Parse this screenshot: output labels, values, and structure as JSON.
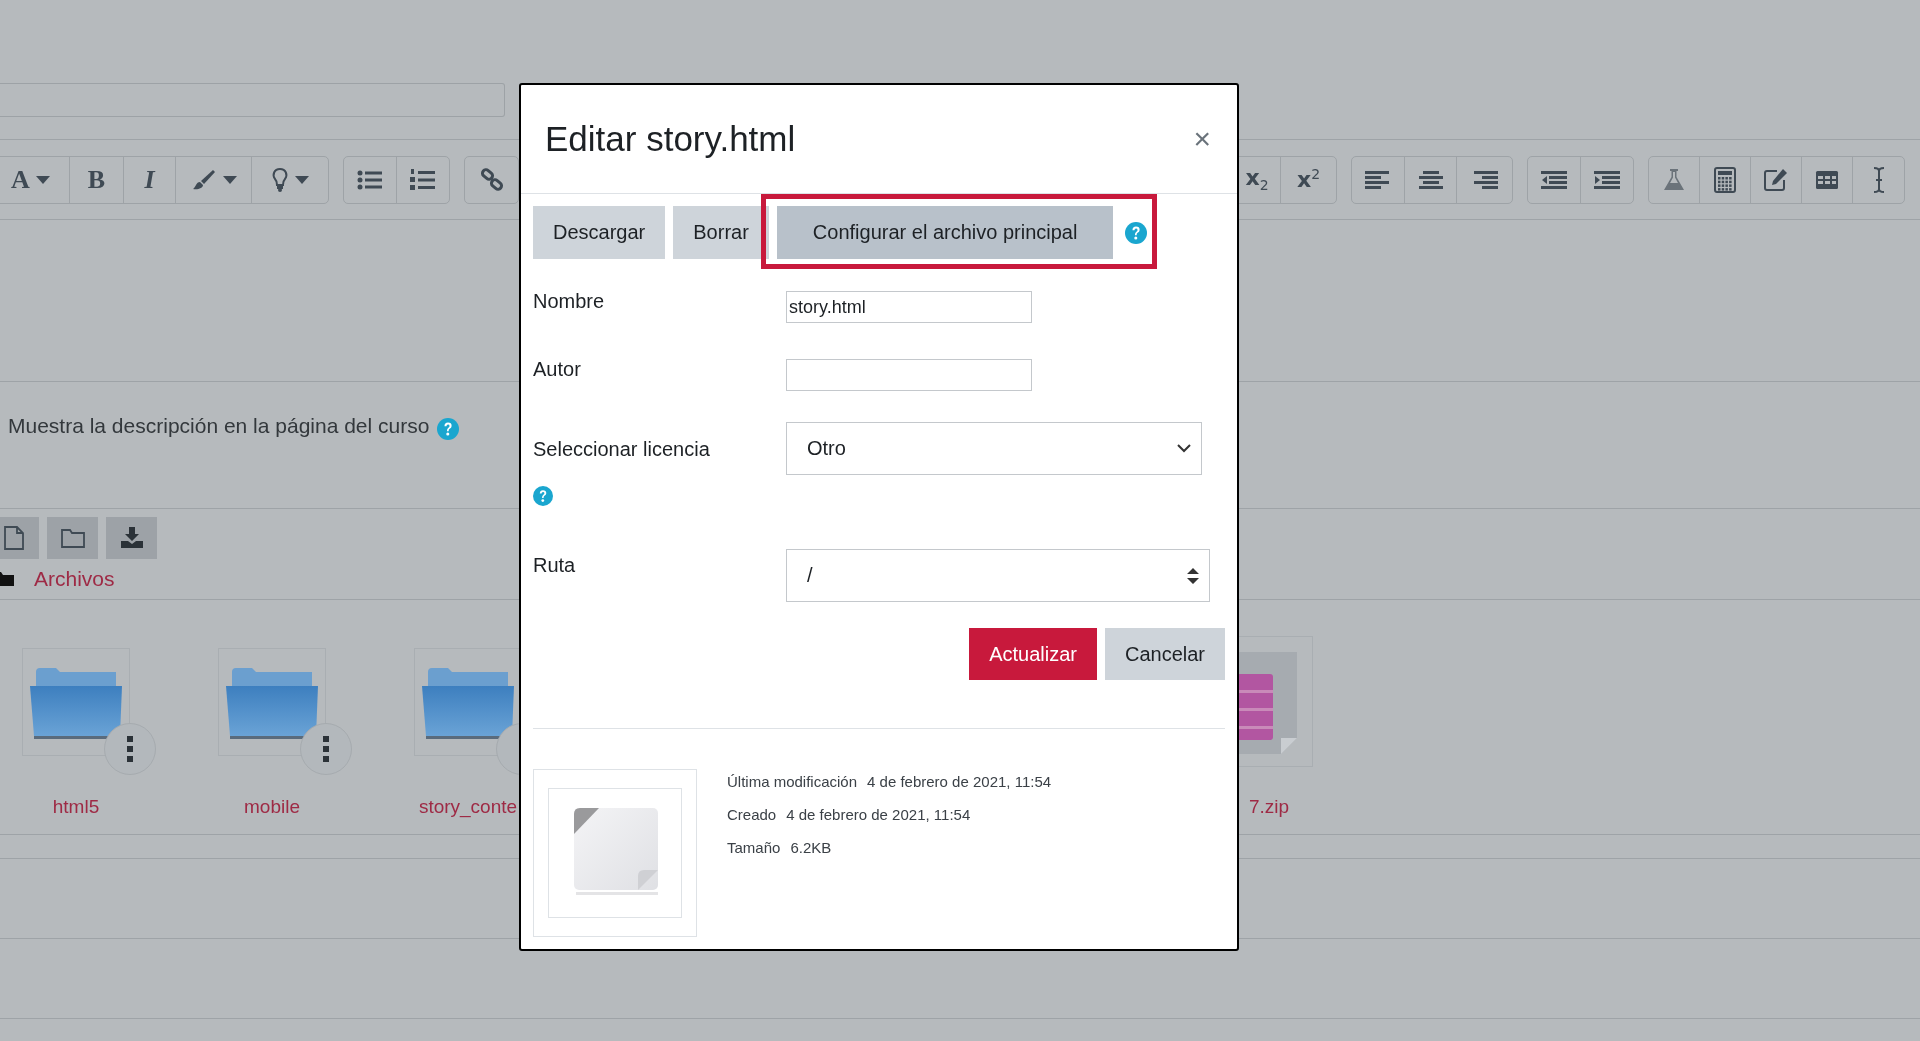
{
  "editor_toolbar": {
    "left_groups": [
      [
        {
          "kind": "font",
          "text": "A",
          "menu": true
        },
        {
          "kind": "bold",
          "text": "B",
          "menu": false
        },
        {
          "kind": "italic",
          "text": "I",
          "menu": false
        },
        {
          "kind": "brush",
          "menu": true
        },
        {
          "kind": "bulb",
          "menu": true
        }
      ],
      [
        {
          "kind": "bullets",
          "menu": false
        },
        {
          "kind": "numbers",
          "menu": false
        }
      ],
      [
        {
          "kind": "link",
          "menu": false
        }
      ]
    ],
    "right_groups": [
      [
        {
          "kind": "subscript",
          "text": "x$_{2}$",
          "menu": false
        },
        {
          "kind": "superscript",
          "text": "x$^{2}$",
          "menu": false
        }
      ],
      [
        {
          "kind": "align-left",
          "menu": false
        },
        {
          "kind": "align-center",
          "menu": false
        },
        {
          "kind": "align-right",
          "menu": false
        }
      ],
      [
        {
          "kind": "outdent",
          "menu": false
        },
        {
          "kind": "indent",
          "menu": false
        }
      ],
      [
        {
          "kind": "flask",
          "menu": false
        },
        {
          "kind": "calculator",
          "menu": false
        },
        {
          "kind": "edit",
          "menu": false
        },
        {
          "kind": "table",
          "menu": false
        },
        {
          "kind": "cursor",
          "menu": false
        }
      ]
    ]
  },
  "description_setting": {
    "label": "Muestra la descripción en la página del curso"
  },
  "file_manager": {
    "path": "Archivos",
    "items": [
      {
        "name": "html5",
        "kind": "folder"
      },
      {
        "name": "mobile",
        "kind": "folder"
      },
      {
        "name": "story_conte",
        "kind": "folder"
      },
      {
        "name": "7.zip",
        "kind": "zip"
      }
    ]
  },
  "dialog": {
    "title": "Editar story.html",
    "close": "×",
    "actions": [
      {
        "label": "Descargar",
        "highlighted": false
      },
      {
        "label": "Borrar",
        "highlighted": false
      },
      {
        "label": "Configurar el archivo principal",
        "highlighted": true
      }
    ],
    "fields": [
      {
        "kind": "text",
        "label": "Nombre",
        "value": "story.html",
        "help": false
      },
      {
        "kind": "text",
        "label": "Autor",
        "help": false
      },
      {
        "kind": "select",
        "label": "Seleccionar licencia",
        "value": "Otro",
        "help": true
      },
      {
        "kind": "path",
        "label": "Ruta",
        "value": "/",
        "help": false
      }
    ],
    "buttons": [
      {
        "label": "Actualizar",
        "kind": "primary"
      },
      {
        "label": "Cancelar",
        "kind": "secondary"
      }
    ],
    "details": [
      {
        "label": "Última modificación",
        "value": "4 de febrero de 2021, 11:54"
      },
      {
        "label": "Creado",
        "value": "4 de febrero de 2021, 11:54"
      },
      {
        "label": "Tamaño",
        "value": "6.2KB"
      }
    ]
  }
}
